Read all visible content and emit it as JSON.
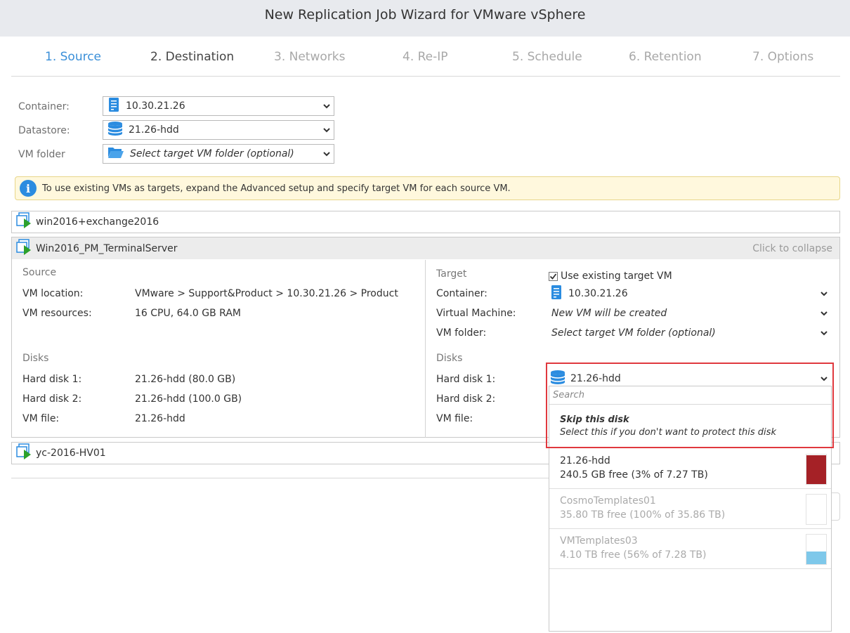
{
  "window": {
    "title": "New Replication Job Wizard for VMware vSphere"
  },
  "steps": [
    {
      "label": "1. Source",
      "state": "done"
    },
    {
      "label": "2. Destination",
      "state": "current"
    },
    {
      "label": "3. Networks",
      "state": "pending"
    },
    {
      "label": "4. Re-IP",
      "state": "pending"
    },
    {
      "label": "5. Schedule",
      "state": "pending"
    },
    {
      "label": "6. Retention",
      "state": "pending"
    },
    {
      "label": "7. Options",
      "state": "pending"
    }
  ],
  "destination": {
    "container": {
      "label": "Container:",
      "value": "10.30.21.26",
      "icon": "server-icon"
    },
    "datastore": {
      "label": "Datastore:",
      "value": "21.26-hdd",
      "icon": "datastore-icon"
    },
    "vm_folder": {
      "label": "VM folder",
      "placeholder": "Select target VM folder (optional)",
      "icon": "folder-icon"
    }
  },
  "info_banner": {
    "text": "To use existing VMs as targets, expand the Advanced setup and specify target VM for each source VM."
  },
  "vms": [
    {
      "name": "win2016+exchange2016"
    },
    {
      "name": "Win2016_PM_TerminalServer",
      "collapse_label": "Click to collapse"
    },
    {
      "name": "yc-2016-HV01"
    }
  ],
  "expanded_vm": {
    "source": {
      "heading": "Source",
      "vm_location_label": "VM location:",
      "vm_location": "VMware > Support&Product > 10.30.21.26 > Product",
      "vm_resources_label": "VM resources:",
      "vm_resources": "16 CPU, 64.0 GB RAM",
      "disks_heading": "Disks",
      "disks": [
        {
          "label": "Hard disk 1:",
          "value": "21.26-hdd (80.0 GB)"
        },
        {
          "label": "Hard disk 2:",
          "value": "21.26-hdd (100.0 GB)"
        },
        {
          "label": "VM file:",
          "value": "21.26-hdd"
        }
      ]
    },
    "target": {
      "heading": "Target",
      "use_existing_label": "Use existing target VM",
      "use_existing_checked": true,
      "container_label": "Container:",
      "container_value": "10.30.21.26",
      "vm_label": "Virtual Machine:",
      "vm_value": "New VM will be created",
      "folder_label": "VM folder:",
      "folder_value": "Select target VM folder (optional)",
      "disks_heading": "Disks",
      "disk_labels": [
        "Hard disk 1:",
        "Hard disk 2:",
        "VM file:"
      ],
      "hard_disk_1_value": "21.26-hdd"
    }
  },
  "datastore_dropdown": {
    "search_placeholder": "Search",
    "skip": {
      "title": "Skip this disk",
      "subtitle": "Select this if you don't want to protect this disk"
    },
    "options": [
      {
        "name": "21.26-hdd",
        "free": "240.5 GB free (3% of 7.27 TB)",
        "used_fraction": 0.97,
        "color": "#a52126",
        "enabled": true
      },
      {
        "name": "CosmoTemplates01",
        "free": "35.80 TB free (100% of 35.86 TB)",
        "used_fraction": 0.0,
        "color": "#ffffff",
        "enabled": false
      },
      {
        "name": "VMTemplates03",
        "free": "4.10 TB free (56% of 7.28 TB)",
        "used_fraction": 0.44,
        "color": "#7ec8ea",
        "enabled": false
      }
    ]
  }
}
